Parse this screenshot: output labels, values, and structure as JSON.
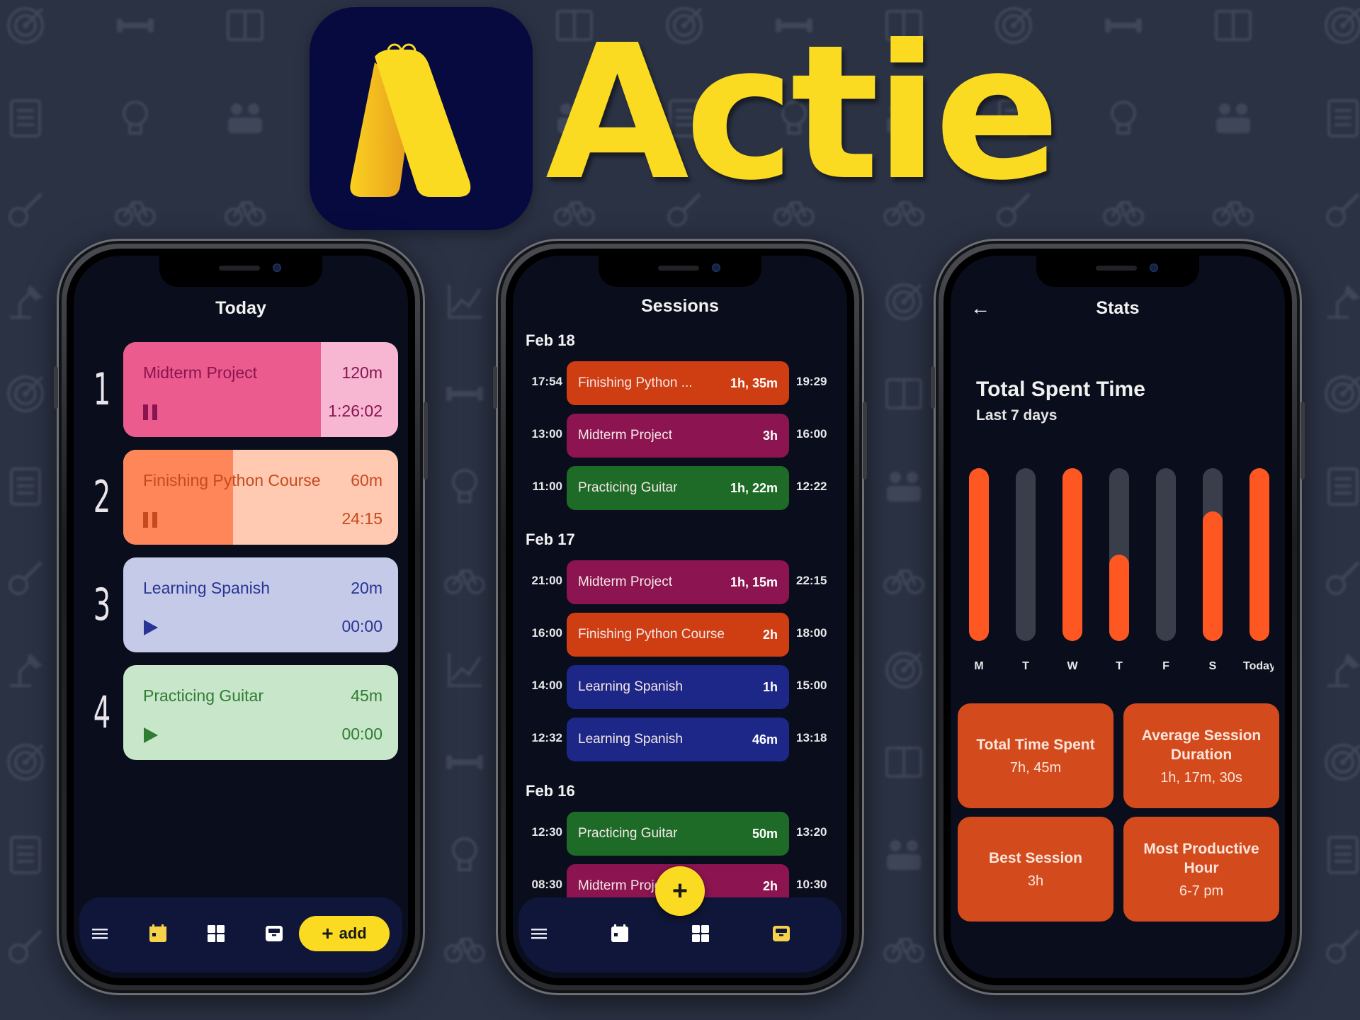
{
  "brand": {
    "app_name": "Actie",
    "logo_icon": "notepad-a-logo",
    "colors": {
      "yellow": "#fbdb22",
      "navy": "#070a3f",
      "background": "#2b3244"
    }
  },
  "background_pattern_icons": [
    "target-icon",
    "dumbbell-icon",
    "book-icon",
    "chart-icon",
    "clipboard-icon",
    "lightbulb-icon",
    "people-icon",
    "lamp-icon",
    "guitar-icon",
    "bike-icon"
  ],
  "today_screen": {
    "title": "Today",
    "tasks": [
      {
        "rank": "1",
        "name": "Midterm Project",
        "goal": "120m",
        "elapsed": "1:26:02",
        "state": "paused",
        "progress": 0.72,
        "bg": "#f7b6d2",
        "fill": "#ec5b8e",
        "text": "#8a1450"
      },
      {
        "rank": "2",
        "name": "Finishing Python Course",
        "goal": "60m",
        "elapsed": "24:15",
        "state": "paused",
        "progress": 0.4,
        "bg": "#ffc9b2",
        "fill": "#ff8659",
        "text": "#c64a1e"
      },
      {
        "rank": "3",
        "name": "Learning Spanish",
        "goal": "20m",
        "elapsed": "00:00",
        "state": "stopped",
        "progress": 0,
        "bg": "#c5cae9",
        "fill": "#9fa8da",
        "text": "#283593"
      },
      {
        "rank": "4",
        "name": "Practicing Guitar",
        "goal": "45m",
        "elapsed": "00:00",
        "state": "stopped",
        "progress": 0,
        "bg": "#c8e6c9",
        "fill": "#81c784",
        "text": "#2e7d32"
      }
    ],
    "nav": {
      "menu_icon": "hamburger-menu-icon",
      "calendar_icon": "calendar-icon",
      "grid_icon": "grid-icon",
      "archive_icon": "archive-box-icon",
      "add_label": "add",
      "add_symbol": "+"
    }
  },
  "sessions_screen": {
    "title": "Sessions",
    "groups": [
      {
        "date": "Feb 18",
        "sessions": [
          {
            "start": "17:54",
            "name": "Finishing Python ...",
            "duration": "1h, 35m",
            "end": "19:29",
            "color": "#cf3d12"
          },
          {
            "start": "13:00",
            "name": "Midterm Project",
            "duration": "3h",
            "end": "16:00",
            "color": "#8c1450"
          },
          {
            "start": "11:00",
            "name": "Practicing Guitar",
            "duration": "1h, 22m",
            "end": "12:22",
            "color": "#1e6b27"
          }
        ]
      },
      {
        "date": "Feb 17",
        "sessions": [
          {
            "start": "21:00",
            "name": "Midterm Project",
            "duration": "1h, 15m",
            "end": "22:15",
            "color": "#8c1450"
          },
          {
            "start": "16:00",
            "name": "Finishing Python Course",
            "duration": "2h",
            "end": "18:00",
            "color": "#cf3d12"
          },
          {
            "start": "14:00",
            "name": "Learning Spanish",
            "duration": "1h",
            "end": "15:00",
            "color": "#1d2787"
          },
          {
            "start": "12:32",
            "name": "Learning Spanish",
            "duration": "46m",
            "end": "13:18",
            "color": "#1d2787"
          }
        ]
      },
      {
        "date": "Feb 16",
        "sessions": [
          {
            "start": "12:30",
            "name": "Practicing Guitar",
            "duration": "50m",
            "end": "13:20",
            "color": "#1e6b27"
          },
          {
            "start": "08:30",
            "name": "Midterm Project",
            "duration": "2h",
            "end": "10:30",
            "color": "#8c1450"
          }
        ]
      }
    ],
    "fab_symbol": "+",
    "active_nav": "archive"
  },
  "stats_screen": {
    "title": "Stats",
    "back_icon": "arrow-left-icon",
    "heading": "Total Spent Time",
    "subheading": "Last 7 days",
    "tiles": [
      {
        "label": "Total Time Spent",
        "value": "7h, 45m"
      },
      {
        "label": "Average Session Duration",
        "value": "1h, 17m, 30s"
      },
      {
        "label": "Best Session",
        "value": "3h"
      },
      {
        "label": "Most Productive Hour",
        "value": "6-7 pm"
      }
    ]
  },
  "chart_data": {
    "type": "bar",
    "title": "Total Spent Time",
    "subtitle": "Last 7 days",
    "categories": [
      "M",
      "T",
      "W",
      "T",
      "F",
      "S",
      "Today"
    ],
    "values": [
      1.0,
      0,
      1.0,
      0.5,
      0,
      0.75,
      1.0
    ],
    "value_unit": "fraction of daily goal",
    "ylim": [
      0,
      1
    ],
    "grid": false,
    "colors": {
      "fill": "#ff5722",
      "track": "#3a3d4a"
    },
    "xlabel": "",
    "ylabel": ""
  }
}
